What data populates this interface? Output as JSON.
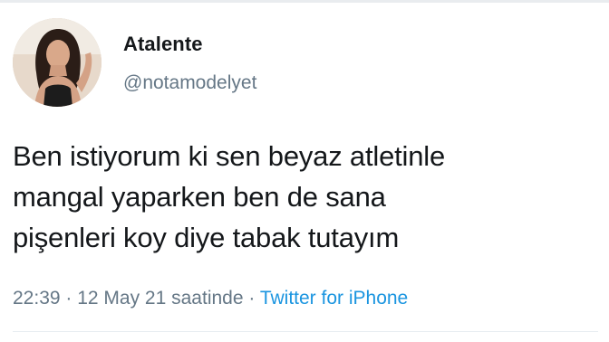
{
  "author": {
    "display_name": "Atalente",
    "handle": "@notamodelyet",
    "avatar_icon": "profile-photo"
  },
  "tweet": {
    "lines": [
      "Ben istiyorum ki sen beyaz atletinle",
      "mangal yaparken ben de sana",
      "pişenleri koy diye tabak tutayım"
    ]
  },
  "meta": {
    "time": "22:39",
    "separator": " · ",
    "date": "12 May 21 saatinde",
    "source": "Twitter for iPhone"
  },
  "colors": {
    "text": "#14171a",
    "secondary": "#657786",
    "link": "#1b95e0"
  }
}
